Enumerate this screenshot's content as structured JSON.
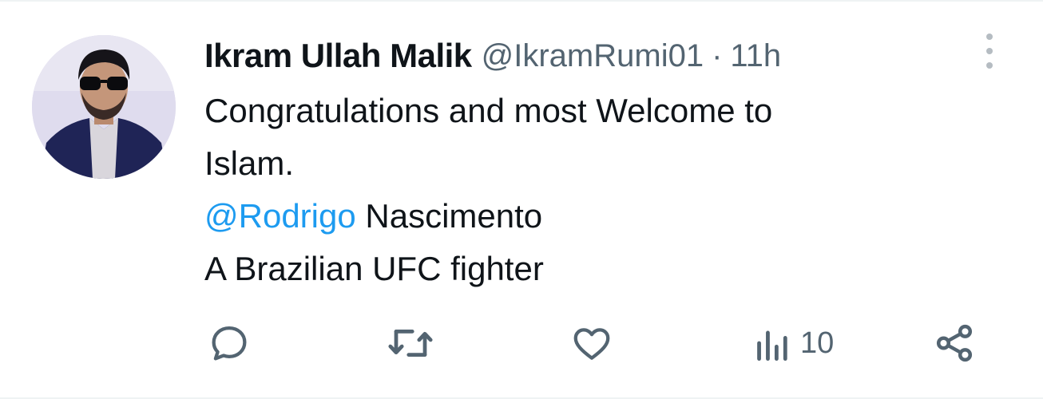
{
  "author": {
    "display_name": "Ikram Ullah Malik",
    "handle": "@IkramRumi01",
    "separator": "·",
    "time": "11h"
  },
  "tweet": {
    "line1": "Congratulations and most Welcome to",
    "line2": "Islam.",
    "mention": "@Rodrigo",
    "mention_rest": " Nascimento",
    "line4": "A Brazilian UFC fighter"
  },
  "actions": {
    "reply_icon": "reply-icon",
    "retweet_icon": "retweet-icon",
    "like_icon": "heart-icon",
    "views_icon": "views-icon",
    "views_count": "10",
    "share_icon": "share-icon"
  },
  "colors": {
    "text": "#0f1419",
    "secondary": "#536471",
    "mention": "#1d9bf0"
  }
}
